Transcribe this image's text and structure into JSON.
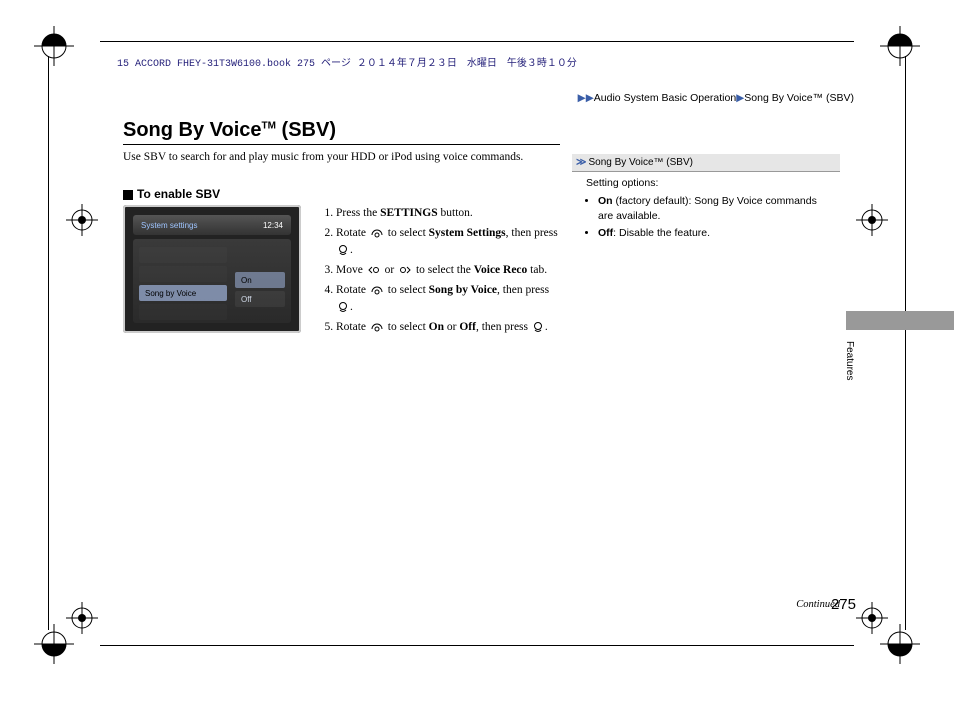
{
  "print_header": "15 ACCORD FHEY-31T3W6100.book  275 ページ  ２０１４年７月２３日　水曜日　午後３時１０分",
  "breadcrumb": {
    "arrows": "▶▶",
    "a": "Audio System Basic Operation",
    "sep": "▶",
    "b": "Song By Voice™ (SBV)"
  },
  "title": {
    "text": "Song By Voice",
    "tm": "TM",
    "suffix": " (SBV)"
  },
  "intro": "Use SBV to search for and play music from your HDD or iPod using voice commands.",
  "subhead": "To enable SBV",
  "screenshot": {
    "title": "System settings",
    "clock": "12:34",
    "row_label": "Song by Voice",
    "opt_on": "On",
    "opt_off": "Off"
  },
  "steps": {
    "s1a": "Press the ",
    "s1b": "SETTINGS",
    "s1c": " button.",
    "s2a": "Rotate ",
    "s2b": " to select ",
    "s2c": "System Settings",
    "s2d": ", then press ",
    "s2e": ".",
    "s3a": "Move ",
    "s3b": " or ",
    "s3c": " to select the ",
    "s3d": "Voice Reco",
    "s3e": " tab.",
    "s4a": "Rotate ",
    "s4b": " to select ",
    "s4c": "Song by Voice",
    "s4d": ", then press ",
    "s4e": ".",
    "s5a": "Rotate ",
    "s5b": " to select ",
    "s5c": "On",
    "s5d": " or ",
    "s5e": "Off",
    "s5f": ", then press ",
    "s5g": "."
  },
  "sidebar": {
    "heading": "Song By Voice™ (SBV)",
    "lead": "Setting options:",
    "items": [
      {
        "term": "On",
        "detail": " (factory default): Song By Voice commands are available."
      },
      {
        "term": "Off",
        "detail": ": Disable the feature."
      }
    ]
  },
  "tab_label": "Features",
  "continued": "Continued",
  "page_number": "275"
}
